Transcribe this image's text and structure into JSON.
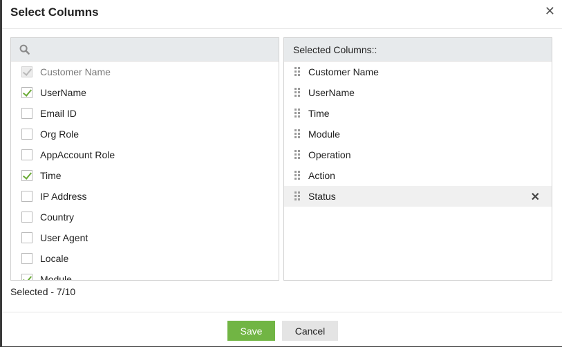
{
  "dialog": {
    "title": "Select Columns",
    "close_icon": "close-icon",
    "search": {
      "placeholder": "",
      "icon": "search-icon"
    },
    "options": [
      {
        "label": "Customer Name",
        "checked": true,
        "disabled": true
      },
      {
        "label": "UserName",
        "checked": true,
        "disabled": false
      },
      {
        "label": "Email ID",
        "checked": false,
        "disabled": false
      },
      {
        "label": "Org Role",
        "checked": false,
        "disabled": false
      },
      {
        "label": "AppAccount Role",
        "checked": false,
        "disabled": false
      },
      {
        "label": "Time",
        "checked": true,
        "disabled": false
      },
      {
        "label": "IP Address",
        "checked": false,
        "disabled": false
      },
      {
        "label": "Country",
        "checked": false,
        "disabled": false
      },
      {
        "label": "User Agent",
        "checked": false,
        "disabled": false
      },
      {
        "label": "Locale",
        "checked": false,
        "disabled": false
      },
      {
        "label": "Module",
        "checked": true,
        "disabled": false
      }
    ],
    "selected_header": "Selected Columns::",
    "selected": [
      "Customer Name",
      "UserName",
      "Time",
      "Module",
      "Operation",
      "Action",
      "Status"
    ],
    "selected_count": "Selected - 7/10",
    "save_label": "Save",
    "cancel_label": "Cancel",
    "accent_color": "#71b544",
    "check_color": "#6aaa35"
  }
}
